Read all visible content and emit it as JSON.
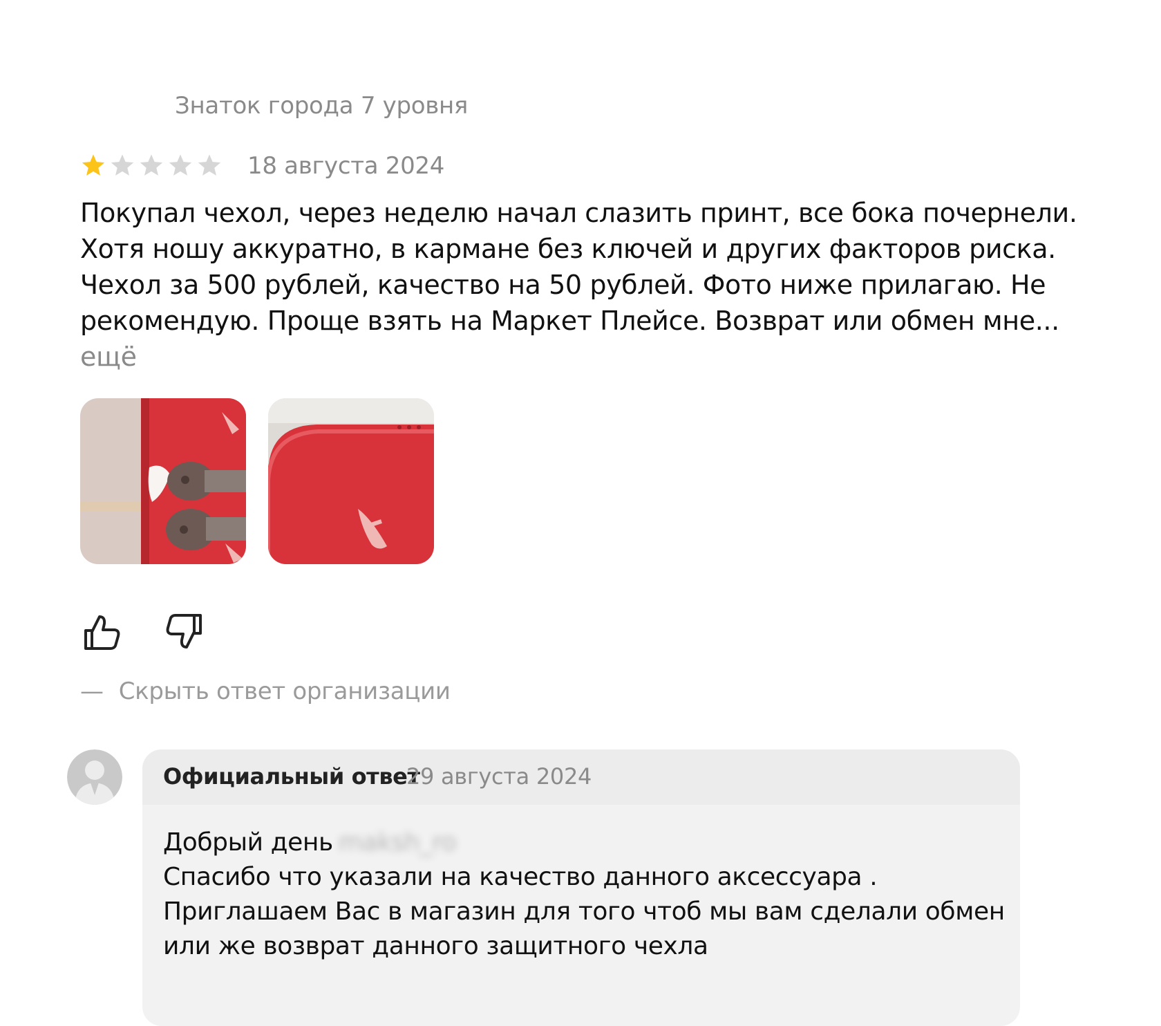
{
  "review": {
    "author_level": "Знаток города 7 уровня",
    "rating": 1,
    "max_rating": 5,
    "date": "18 августа 2024",
    "text_lines": [
      "Покупал чехол, через неделю начал слазить принт, все бока почернели.",
      "Хотя ношу аккуратно, в кармане без ключей и других факторов риска.",
      "Чехол за 500 рублей, качество на 50 рублей. Фото ниже прилагаю. Не",
      "рекомендую. Проще взять на Маркет Плейсе. Возврат или обмен мне..."
    ],
    "more_label": "ещё",
    "photos": [
      "photo-1",
      "photo-2"
    ]
  },
  "actions": {
    "like_icon": "thumb-up-icon",
    "dislike_icon": "thumb-down-icon",
    "toggle_reply_dash": "—",
    "toggle_reply_label": "Скрыть ответ организации"
  },
  "reply": {
    "title": "Официальный ответ",
    "date": "29 августа 2024",
    "greeting": "Добрый день",
    "hidden_name": "maksh_ro",
    "lines": [
      "Спасибо что указали на качество данного аксессуара .",
      "Приглашаем Вас в магазин для того чтоб мы вам сделали обмен",
      "или же возврат данного защитного чехла"
    ]
  },
  "colors": {
    "star_active": "#fcc419",
    "star_inactive": "#d6d6d6",
    "muted_text": "#8a8a8a",
    "reply_bg": "#f2f2f2",
    "photo_red": "#d8323a"
  }
}
